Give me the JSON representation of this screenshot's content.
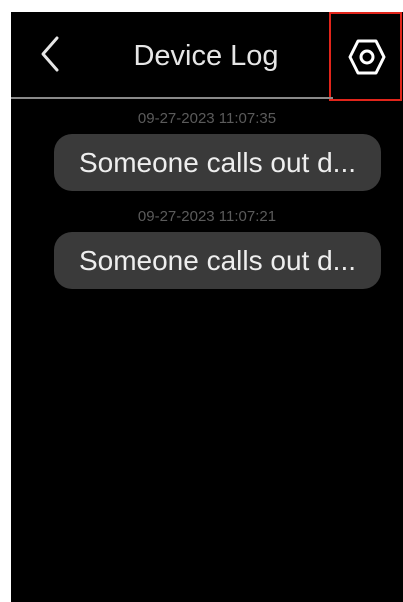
{
  "header": {
    "title": "Device Log",
    "back_icon": "chevron-left-icon",
    "settings_icon": "hexagon-settings-icon",
    "highlight_color": "#e1251b"
  },
  "logs": [
    {
      "timestamp": "09-27-2023 11:07:35",
      "message": "Someone calls out d..."
    },
    {
      "timestamp": "09-27-2023 11:07:21",
      "message": "Someone calls out d..."
    }
  ]
}
